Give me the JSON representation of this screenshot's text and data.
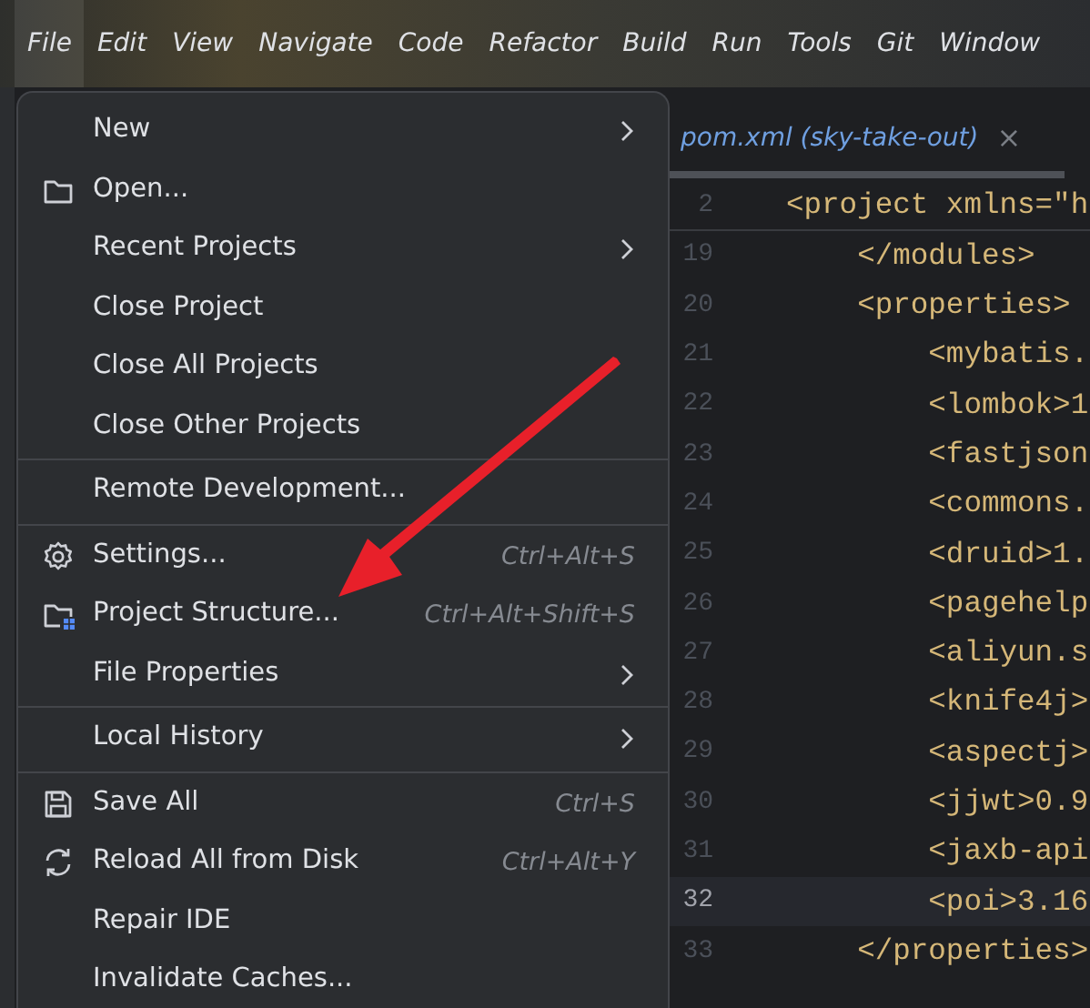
{
  "menubar": [
    {
      "label": "File",
      "selected": true
    },
    {
      "label": "Edit",
      "selected": false
    },
    {
      "label": "View",
      "selected": false
    },
    {
      "label": "Navigate",
      "selected": false
    },
    {
      "label": "Code",
      "selected": false
    },
    {
      "label": "Refactor",
      "selected": false
    },
    {
      "label": "Build",
      "selected": false
    },
    {
      "label": "Run",
      "selected": false
    },
    {
      "label": "Tools",
      "selected": false
    },
    {
      "label": "Git",
      "selected": false
    },
    {
      "label": "Window",
      "selected": false
    }
  ],
  "file_menu": [
    {
      "kind": "item",
      "label": "New",
      "submenu": true
    },
    {
      "kind": "item",
      "label": "Open..."
    },
    {
      "kind": "item",
      "label": "Recent Projects",
      "submenu": true
    },
    {
      "kind": "item",
      "label": "Close Project"
    },
    {
      "kind": "item",
      "label": "Close All Projects"
    },
    {
      "kind": "item",
      "label": "Close Other Projects"
    },
    {
      "kind": "separator"
    },
    {
      "kind": "item",
      "label": "Remote Development..."
    },
    {
      "kind": "separator"
    },
    {
      "kind": "item",
      "label": "Settings...",
      "shortcut": "Ctrl+Alt+S"
    },
    {
      "kind": "item",
      "label": "Project Structure...",
      "shortcut": "Ctrl+Alt+Shift+S"
    },
    {
      "kind": "item",
      "label": "File Properties",
      "submenu": true
    },
    {
      "kind": "separator"
    },
    {
      "kind": "item",
      "label": "Local History",
      "submenu": true
    },
    {
      "kind": "separator"
    },
    {
      "kind": "item",
      "label": "Save All",
      "shortcut": "Ctrl+S"
    },
    {
      "kind": "item",
      "label": "Reload All from Disk",
      "shortcut": "Ctrl+Alt+Y"
    },
    {
      "kind": "item",
      "label": "Repair IDE"
    },
    {
      "kind": "item",
      "label": "Invalidate Caches..."
    }
  ],
  "editor": {
    "tab": {
      "label": "pom.xml (sky-take-out)",
      "close": "×"
    },
    "lines": [
      {
        "number": "2",
        "code": "<project xmlns=\"h",
        "current": false,
        "sticky": true
      },
      {
        "number": "19",
        "code": "    </modules>",
        "current": false,
        "sticky": false
      },
      {
        "number": "20",
        "code": "    <properties>",
        "current": false,
        "sticky": false
      },
      {
        "number": "21",
        "code": "        <mybatis.",
        "current": false,
        "sticky": false
      },
      {
        "number": "22",
        "code": "        <lombok>1",
        "current": false,
        "sticky": false
      },
      {
        "number": "23",
        "code": "        <fastjson",
        "current": false,
        "sticky": false
      },
      {
        "number": "24",
        "code": "        <commons.",
        "current": false,
        "sticky": false
      },
      {
        "number": "25",
        "code": "        <druid>1.",
        "current": false,
        "sticky": false
      },
      {
        "number": "26",
        "code": "        <pagehelp",
        "current": false,
        "sticky": false
      },
      {
        "number": "27",
        "code": "        <aliyun.s",
        "current": false,
        "sticky": false
      },
      {
        "number": "28",
        "code": "        <knife4j>",
        "current": false,
        "sticky": false
      },
      {
        "number": "29",
        "code": "        <aspectj>",
        "current": false,
        "sticky": false
      },
      {
        "number": "30",
        "code": "        <jjwt>0.9",
        "current": false,
        "sticky": false
      },
      {
        "number": "31",
        "code": "        <jaxb-api",
        "current": false,
        "sticky": false
      },
      {
        "number": "32",
        "code": "        <poi>3.16",
        "current": true,
        "sticky": false
      },
      {
        "number": "33",
        "code": "    </properties>",
        "current": false,
        "sticky": false
      }
    ]
  },
  "overlay": {
    "kind": "arrow"
  }
}
